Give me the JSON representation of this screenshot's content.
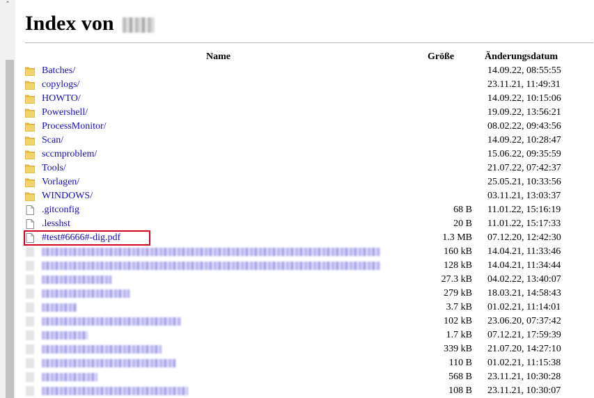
{
  "page": {
    "title": "Index von",
    "columns": {
      "name": "Name",
      "size": "Größe",
      "modified": "Änderungsdatum"
    }
  },
  "scrollbar": {
    "up_arrow": "˄"
  },
  "entries": [
    {
      "type": "folder",
      "name": "Batches/",
      "size": "",
      "date": "14.09.22, 08:55:55"
    },
    {
      "type": "folder",
      "name": "copylogs/",
      "size": "",
      "date": "23.11.21, 11:49:31"
    },
    {
      "type": "folder",
      "name": "HOWTO/",
      "size": "",
      "date": "14.09.22, 10:15:06"
    },
    {
      "type": "folder",
      "name": "Powershell/",
      "size": "",
      "date": "19.09.22, 13:56:21"
    },
    {
      "type": "folder",
      "name": "ProcessMonitor/",
      "size": "",
      "date": "08.02.22, 09:43:56"
    },
    {
      "type": "folder",
      "name": "Scan/",
      "size": "",
      "date": "14.09.22, 10:28:47"
    },
    {
      "type": "folder",
      "name": "sccmproblem/",
      "size": "",
      "date": "15.06.22, 09:35:59"
    },
    {
      "type": "folder",
      "name": "Tools/",
      "size": "",
      "date": "21.07.22, 07:42:37"
    },
    {
      "type": "folder",
      "name": "Vorlagen/",
      "size": "",
      "date": "25.05.21, 10:33:56"
    },
    {
      "type": "folder",
      "name": "WINDOWS/",
      "size": "",
      "date": "03.11.21, 13:03:37"
    },
    {
      "type": "file",
      "name": ".gitconfig",
      "size": "68 B",
      "date": "11.01.22, 15:16:19"
    },
    {
      "type": "file",
      "name": ".lesshst",
      "size": "20 B",
      "date": "11.01.22, 15:17:33"
    },
    {
      "type": "file",
      "name": "#test#6666#-dig.pdf",
      "size": "1.3 MB",
      "date": "07.12.20, 12:42:30",
      "highlighted": true
    },
    {
      "type": "redacted",
      "size": "160 kB",
      "date": "14.04.21, 11:33:46"
    },
    {
      "type": "redacted",
      "size": "128 kB",
      "date": "14.04.21, 11:34:44"
    },
    {
      "type": "redacted",
      "size": "27.3 kB",
      "date": "04.02.22, 13:40:07"
    },
    {
      "type": "redacted",
      "size": "279 kB",
      "date": "18.03.21, 14:58:43"
    },
    {
      "type": "redacted",
      "size": "3.7 kB",
      "date": "01.02.21, 11:14:01"
    },
    {
      "type": "redacted",
      "size": "102 kB",
      "date": "23.06.20, 07:37:42"
    },
    {
      "type": "redacted",
      "size": "1.7 kB",
      "date": "07.12.21, 17:59:39"
    },
    {
      "type": "redacted",
      "size": "339 kB",
      "date": "21.07.20, 14:27:10"
    },
    {
      "type": "redacted",
      "size": "110 B",
      "date": "01.02.21, 11:15:38"
    },
    {
      "type": "redacted",
      "size": "568 B",
      "date": "23.11.21, 10:30:28"
    },
    {
      "type": "redacted",
      "size": "108 B",
      "date": "23.11.21, 10:30:07"
    }
  ]
}
